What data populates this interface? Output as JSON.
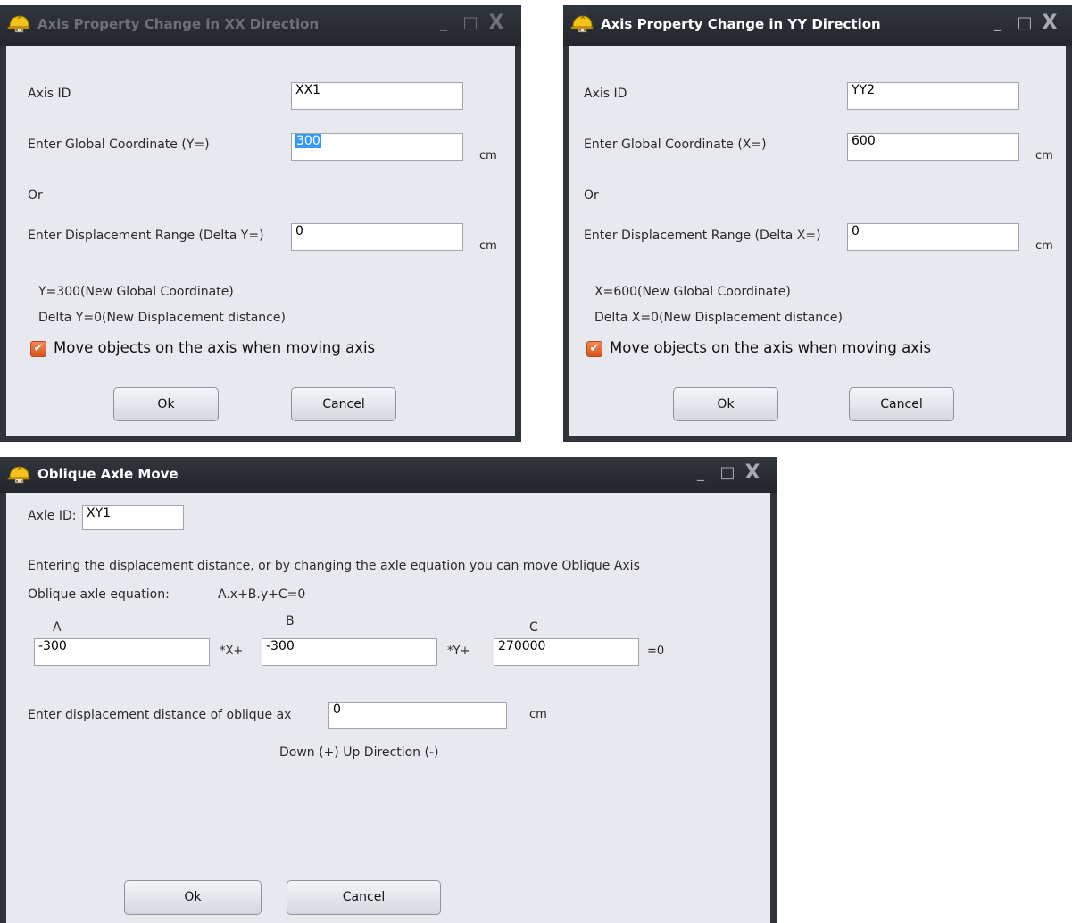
{
  "win_xx": {
    "title": "Axis Property Change in XX Direction",
    "axis_id_label": "Axis ID",
    "axis_id_value": "XX1",
    "coord_label": "Enter Global Coordinate (Y=)",
    "coord_value": "300",
    "coord_unit": "cm",
    "or_label": "Or",
    "disp_label": "Enter Displacement Range (Delta Y=)",
    "disp_value": "0",
    "disp_unit": "cm",
    "info_coord": "Y=300(New Global Coordinate)",
    "info_disp": "Delta Y=0(New Displacement distance)",
    "checkbox_label": "Move objects on the axis when moving axis",
    "checkbox_checked": true,
    "ok_label": "Ok",
    "cancel_label": "Cancel"
  },
  "win_yy": {
    "title": "Axis Property Change in YY Direction",
    "axis_id_label": "Axis ID",
    "axis_id_value": "YY2",
    "coord_label": "Enter Global Coordinate (X=)",
    "coord_value": "600",
    "coord_unit": "cm",
    "or_label": "Or",
    "disp_label": "Enter Displacement Range (Delta X=)",
    "disp_value": "0",
    "disp_unit": "cm",
    "info_coord": "X=600(New Global Coordinate)",
    "info_disp": "Delta X=0(New Displacement distance)",
    "checkbox_label": "Move objects on the axis when moving axis",
    "checkbox_checked": true,
    "ok_label": "Ok",
    "cancel_label": "Cancel"
  },
  "win_oblique": {
    "title": "Oblique Axle Move",
    "axle_id_label": "Axle ID:",
    "axle_id_value": "XY1",
    "instruction": "Entering the displacement distance, or by changing the axle equation you can move Oblique Axis",
    "equation_label": "Oblique axle equation:",
    "equation_text": "A.x+B.y+C=0",
    "coef_a_label": "A",
    "coef_b_label": "B",
    "coef_c_label": "C",
    "coef_a_value": "-300",
    "coef_b_value": "-300",
    "coef_c_value": "270000",
    "x_suffix": "*X+",
    "y_suffix": "*Y+",
    "eq_suffix": "=0",
    "disp_label": "Enter displacement distance of oblique ax",
    "disp_value": "0",
    "disp_unit": "cm",
    "direction_hint": "Down  (+)  Up Direction (-)",
    "ok_label": "Ok",
    "cancel_label": "Cancel"
  },
  "window_controls": {
    "minimize": "_",
    "maximize": "□",
    "close": "X"
  },
  "icons": {
    "window_icon": "helmet-icon"
  },
  "colors": {
    "titlebar": "#2b2e34",
    "client": "#e7e9ef",
    "checkbox": "#e06a33",
    "selection": "#3399ff"
  }
}
